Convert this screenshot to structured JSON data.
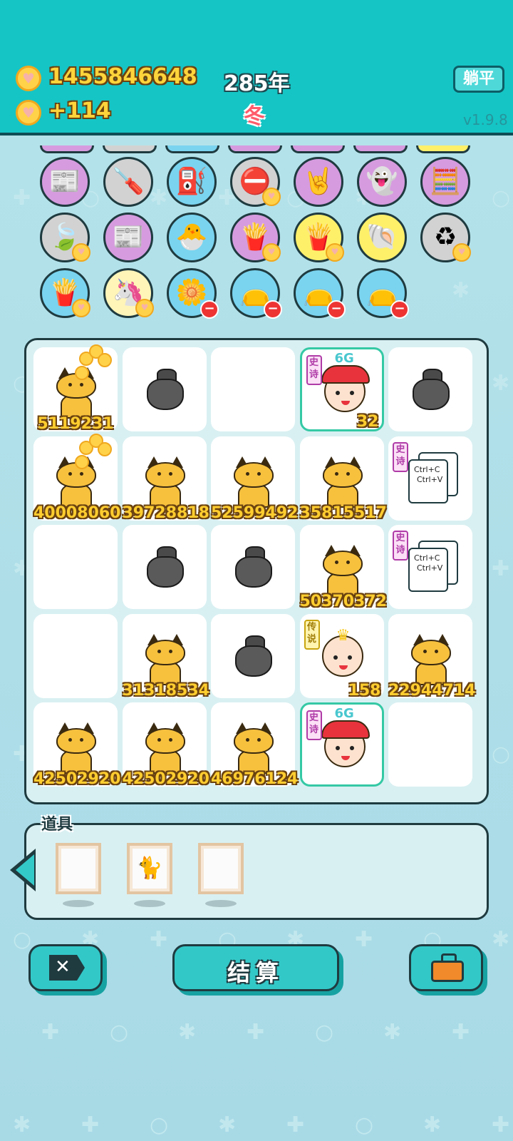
{
  "header": {
    "coins": "1455846648",
    "income": "+114",
    "year": "285年",
    "season": "冬",
    "flat_button": "躺平",
    "version": "v1.9.8"
  },
  "items": [
    {
      "name": "time-magazine-icon",
      "bg": "purple",
      "glyph": "📰",
      "badge": ""
    },
    {
      "name": "screwdriver-icon",
      "bg": "gray",
      "glyph": "🪛",
      "badge": ""
    },
    {
      "name": "pump-icon",
      "bg": "blue",
      "glyph": "⛽",
      "badge": ""
    },
    {
      "name": "minus-sign-icon",
      "bg": "gray",
      "glyph": "⛔",
      "badge": "coin"
    },
    {
      "name": "rock-hand-icon",
      "bg": "purple",
      "glyph": "🤘",
      "badge": ""
    },
    {
      "name": "ghost-icon",
      "bg": "purple",
      "glyph": "👻",
      "badge": ""
    },
    {
      "name": "math-sheet-icon",
      "bg": "purple",
      "glyph": "🧮",
      "badge": ""
    },
    {
      "name": "leaf-icon",
      "bg": "gray",
      "glyph": "🍃",
      "badge": "coin"
    },
    {
      "name": "time-magazine-icon",
      "bg": "purple",
      "glyph": "📰",
      "badge": ""
    },
    {
      "name": "chick-egg-icon",
      "bg": "blue",
      "glyph": "🐣",
      "badge": ""
    },
    {
      "name": "fries-icon",
      "bg": "purple",
      "glyph": "🍟",
      "badge": "coin"
    },
    {
      "name": "fries-icon",
      "bg": "yellow",
      "glyph": "🍟",
      "badge": "coin"
    },
    {
      "name": "shell-icon",
      "bg": "yellow",
      "glyph": "🐚",
      "badge": ""
    },
    {
      "name": "recycle-icon",
      "bg": "gray",
      "glyph": "♻",
      "badge": "coin"
    },
    {
      "name": "fries-icon",
      "bg": "blue",
      "glyph": "🍟",
      "badge": "coin"
    },
    {
      "name": "unicorn-icon",
      "bg": "cream",
      "glyph": "🦄",
      "badge": "coin"
    },
    {
      "name": "flower-pot-icon",
      "bg": "blue",
      "glyph": "🌼",
      "badge": "minus"
    },
    {
      "name": "sandbag-icon",
      "bg": "blue",
      "glyph": "👝",
      "badge": "minus"
    },
    {
      "name": "sandbag-icon",
      "bg": "blue",
      "glyph": "👝",
      "badge": "minus"
    },
    {
      "name": "sandbag-icon",
      "bg": "blue",
      "glyph": "👝",
      "badge": "minus"
    }
  ],
  "board": [
    [
      {
        "type": "cat",
        "value": "5119231",
        "coins": true
      },
      {
        "type": "bag"
      },
      {
        "type": "empty"
      },
      {
        "type": "face",
        "tag": "史诗",
        "g": "6G",
        "value": "32"
      },
      {
        "type": "bag"
      }
    ],
    [
      {
        "type": "cat",
        "value": "40008060",
        "coins": true
      },
      {
        "type": "cat",
        "value": "39728818"
      },
      {
        "type": "cat",
        "value": "52599492"
      },
      {
        "type": "cat",
        "value": "35815517"
      },
      {
        "type": "ctrl",
        "tag": "史诗",
        "line1": "Ctrl+C",
        "line2": "Ctrl+V"
      }
    ],
    [
      {
        "type": "empty"
      },
      {
        "type": "bag"
      },
      {
        "type": "bag"
      },
      {
        "type": "cat",
        "value": "50370372"
      },
      {
        "type": "ctrl",
        "tag": "史诗",
        "line1": "Ctrl+C",
        "line2": "Ctrl+V"
      }
    ],
    [
      {
        "type": "empty"
      },
      {
        "type": "cat",
        "value": "31318534"
      },
      {
        "type": "bag"
      },
      {
        "type": "king",
        "tag": "传说",
        "value": "158"
      },
      {
        "type": "cat",
        "value": "22944714"
      }
    ],
    [
      {
        "type": "cat",
        "value": "42502920"
      },
      {
        "type": "cat",
        "value": "42502920"
      },
      {
        "type": "cat",
        "value": "46976124"
      },
      {
        "type": "face",
        "tag": "史诗",
        "g": "6G",
        "value": ""
      },
      {
        "type": "empty"
      }
    ]
  ],
  "props": {
    "title": "道具"
  },
  "buttons": {
    "settle": "结算"
  }
}
